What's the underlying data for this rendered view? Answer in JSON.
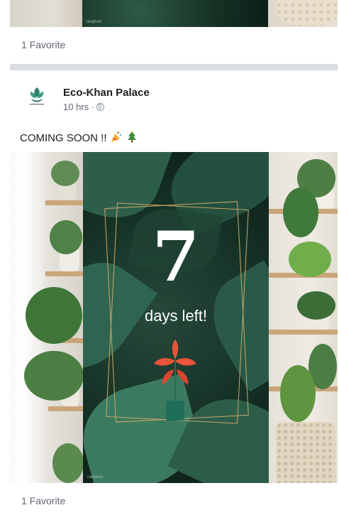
{
  "previous_post": {
    "watermark": "rawpixel",
    "favorites": "1 Favorite"
  },
  "post": {
    "page_name": "Eco-Khan Palace",
    "time": "10 hrs ·",
    "text": "COMING SOON !!",
    "emojis": [
      "party-popper-icon",
      "christmas-tree-icon"
    ],
    "image": {
      "number": "7",
      "caption": "days left!",
      "watermark": "rawpixel"
    },
    "favorites": "1 Favorite"
  },
  "colors": {
    "meta_text": "#606770",
    "divider": "#dadde1",
    "frame_gold": "#c8a96b",
    "flower": "#e8553a",
    "pot_teal": "#1f6e5a"
  }
}
